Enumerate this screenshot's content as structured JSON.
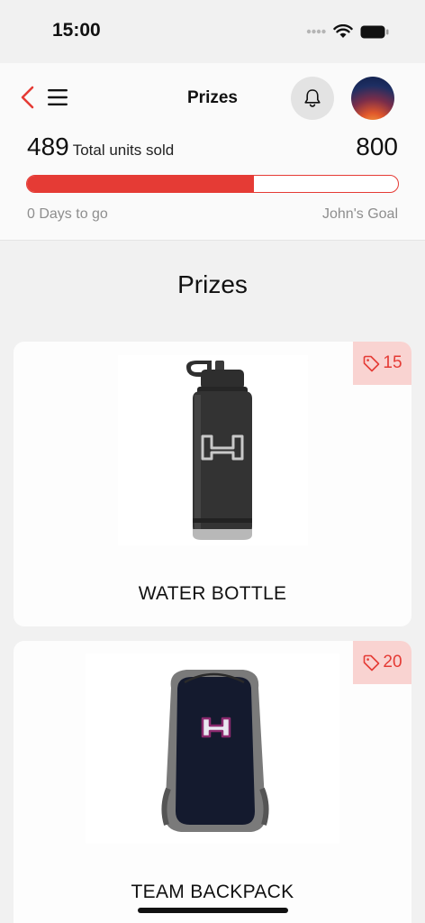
{
  "status_bar": {
    "time": "15:00"
  },
  "header": {
    "title": "Prizes",
    "units_sold": "489",
    "units_sold_label": "Total units sold",
    "goal": "800",
    "progress": 0.611,
    "days_left": "0 Days to go",
    "goal_owner": "John's Goal"
  },
  "section": {
    "title": "Prizes"
  },
  "prizes": [
    {
      "name": "WATER BOTTLE",
      "points": "15"
    },
    {
      "name": "TEAM BACKPACK",
      "points": "20"
    }
  ],
  "colors": {
    "accent": "#e53b35",
    "badge_bg": "#f9d3d1"
  },
  "icons": [
    "back-arrow-icon",
    "menu-icon",
    "bell-icon",
    "tag-icon",
    "wifi-icon",
    "battery-icon",
    "signal-icon"
  ]
}
